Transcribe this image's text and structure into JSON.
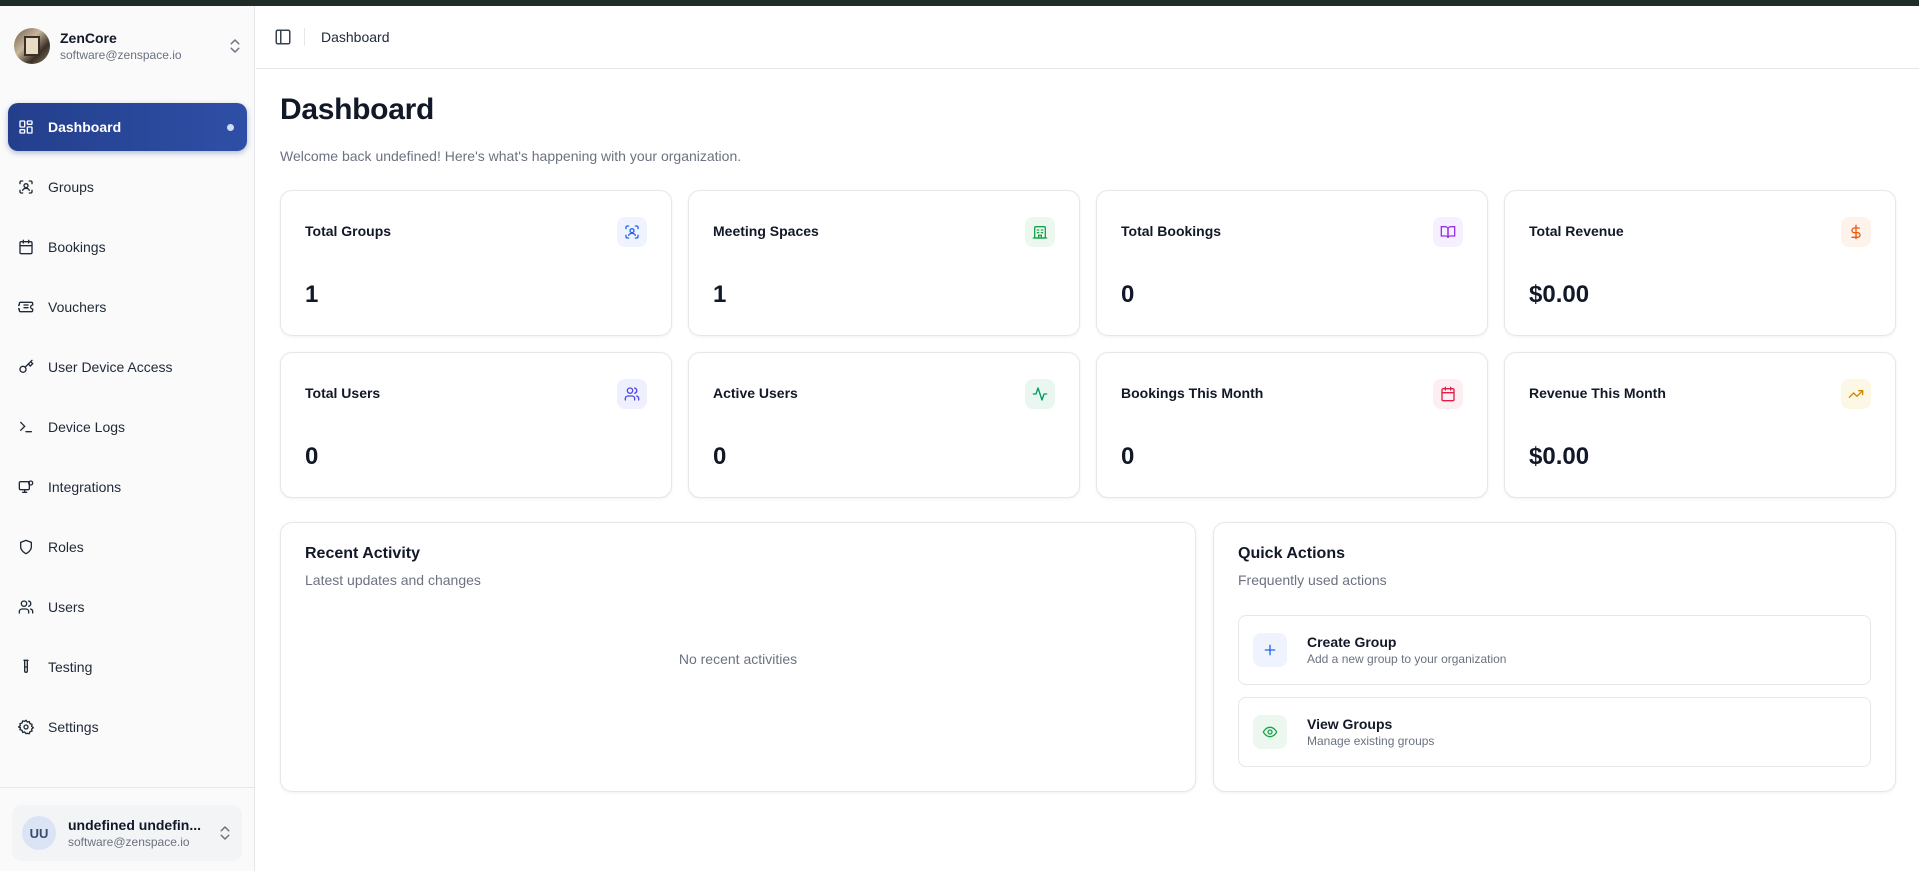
{
  "org": {
    "name": "ZenCore",
    "email": "software@zenspace.io"
  },
  "sidebar": {
    "items": [
      {
        "label": "Dashboard",
        "icon": "dashboard-icon",
        "active": true
      },
      {
        "label": "Groups",
        "icon": "groups-icon"
      },
      {
        "label": "Bookings",
        "icon": "calendar-icon"
      },
      {
        "label": "Vouchers",
        "icon": "ticket-icon"
      },
      {
        "label": "User Device Access",
        "icon": "key-icon"
      },
      {
        "label": "Device Logs",
        "icon": "terminal-icon"
      },
      {
        "label": "Integrations",
        "icon": "monitor-icon"
      },
      {
        "label": "Roles",
        "icon": "shield-icon"
      },
      {
        "label": "Users",
        "icon": "users-icon"
      },
      {
        "label": "Testing",
        "icon": "test-tube-icon"
      },
      {
        "label": "Settings",
        "icon": "gear-icon"
      }
    ]
  },
  "user": {
    "initials": "UU",
    "name": "undefined undefin...",
    "email": "software@zenspace.io"
  },
  "header": {
    "breadcrumb": "Dashboard"
  },
  "main": {
    "title": "Dashboard",
    "subtitle": "Welcome back undefined! Here's what's happening with your organization.",
    "stats": [
      {
        "title": "Total Groups",
        "value": "1",
        "icon": "scan-icon",
        "color": "#2563eb",
        "bg": "#eef3fd"
      },
      {
        "title": "Meeting Spaces",
        "value": "1",
        "icon": "building-icon",
        "color": "#16a34a",
        "bg": "#ecf8ef"
      },
      {
        "title": "Total Bookings",
        "value": "0",
        "icon": "book-open-icon",
        "color": "#9333ea",
        "bg": "#f6effd"
      },
      {
        "title": "Total Revenue",
        "value": "$0.00",
        "icon": "dollar-icon",
        "color": "#ea580c",
        "bg": "#fef3ea"
      },
      {
        "title": "Total Users",
        "value": "0",
        "icon": "users-icon",
        "color": "#4f46e5",
        "bg": "#eff0fd"
      },
      {
        "title": "Active Users",
        "value": "0",
        "icon": "activity-icon",
        "color": "#059669",
        "bg": "#eaf7f1"
      },
      {
        "title": "Bookings This Month",
        "value": "0",
        "icon": "calendar-icon",
        "color": "#e11d48",
        "bg": "#fdeef1"
      },
      {
        "title": "Revenue This Month",
        "value": "$0.00",
        "icon": "trending-up-icon",
        "color": "#ca8a04",
        "bg": "#fdf7e6"
      }
    ],
    "recent": {
      "title": "Recent Activity",
      "subtitle": "Latest updates and changes",
      "empty": "No recent activities"
    },
    "quick": {
      "title": "Quick Actions",
      "subtitle": "Frequently used actions",
      "actions": [
        {
          "title": "Create Group",
          "subtitle": "Add a new group to your organization",
          "icon": "plus-icon",
          "color": "#2563eb",
          "bg": "#eef3fd"
        },
        {
          "title": "View Groups",
          "subtitle": "Manage existing groups",
          "icon": "eye-icon",
          "color": "#16a34a",
          "bg": "#ecf8ef"
        }
      ]
    }
  }
}
